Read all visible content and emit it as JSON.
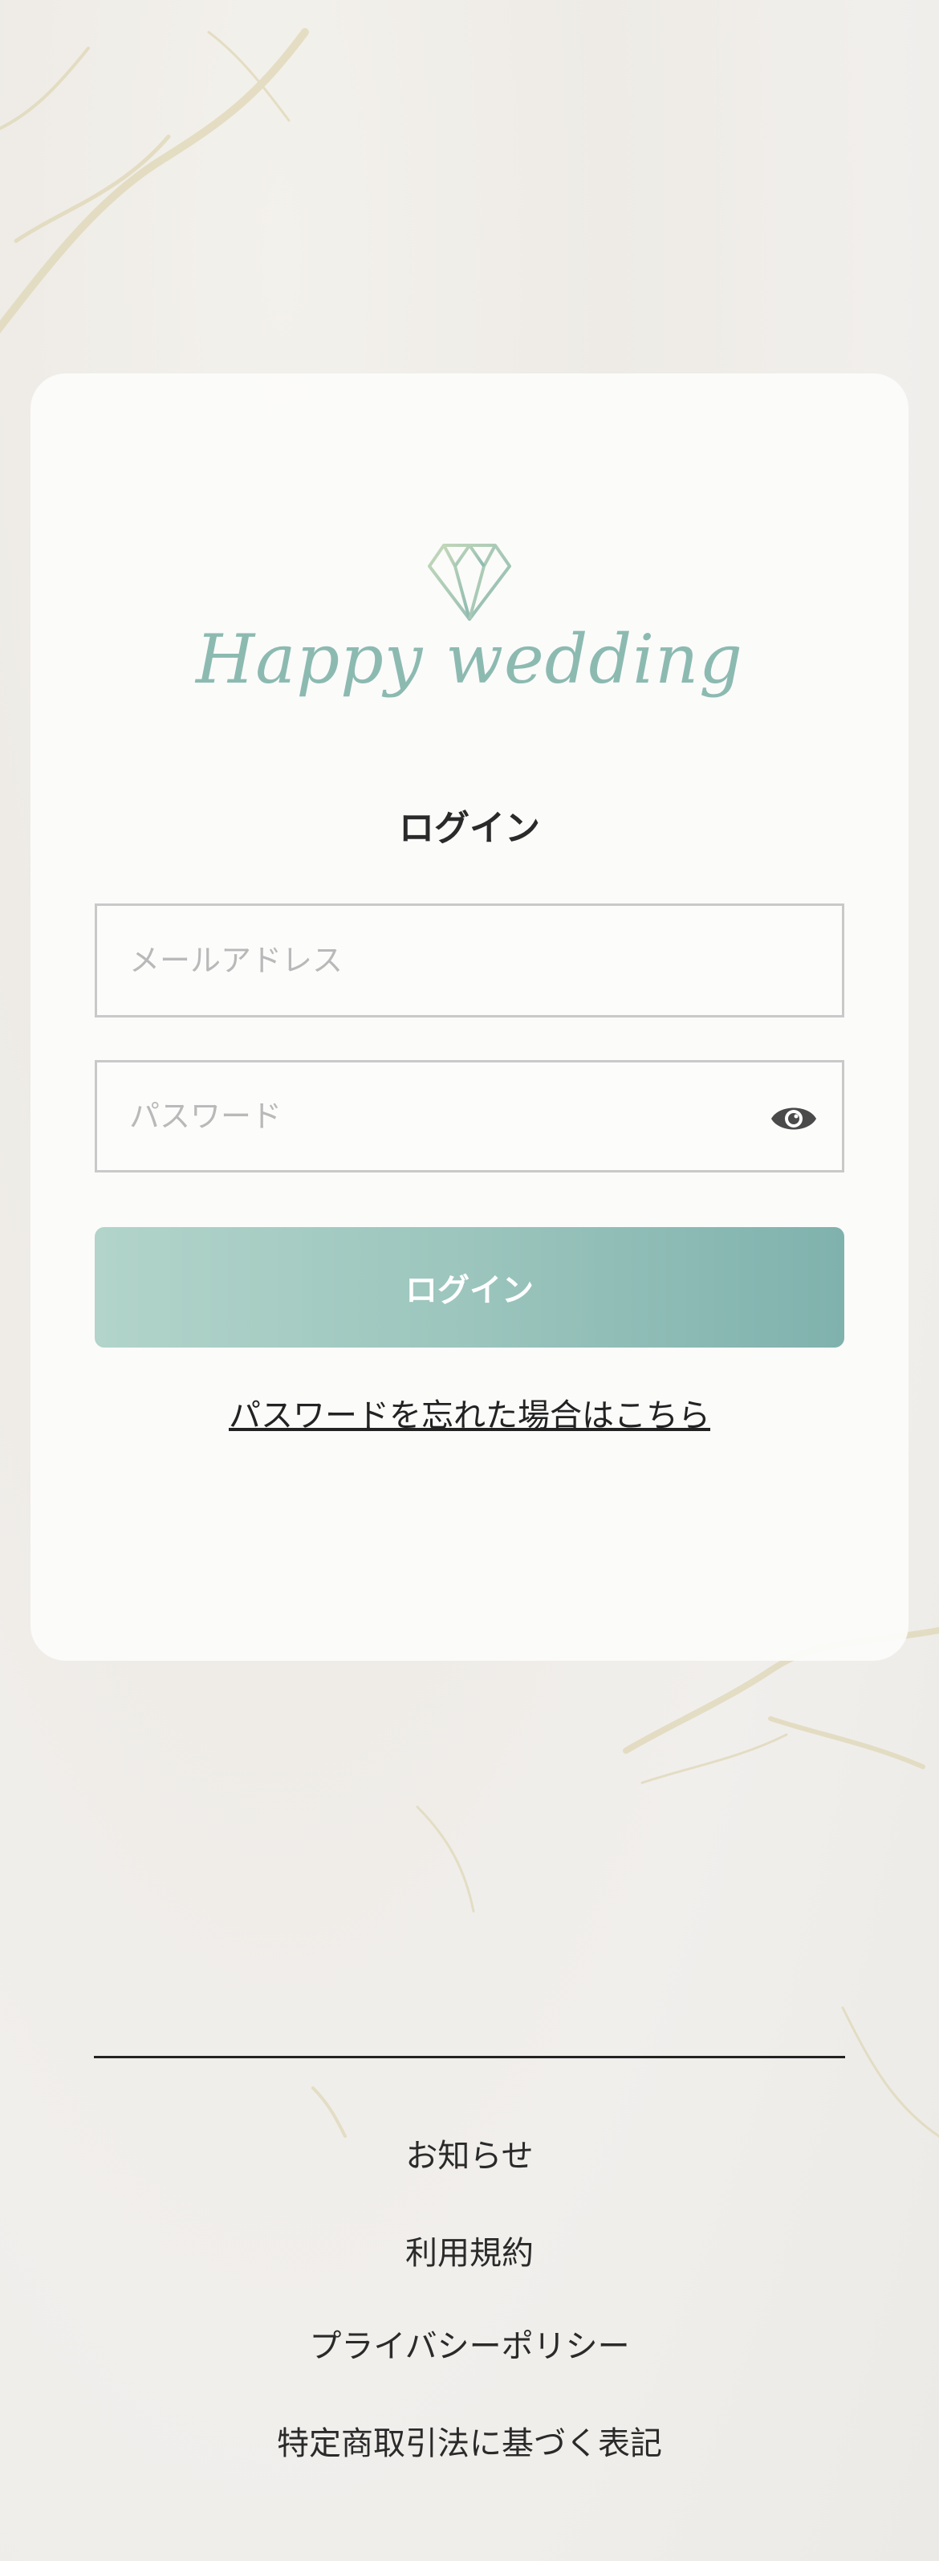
{
  "brand": {
    "logo_text": "Happy wedding",
    "logo_icon": "diamond-icon",
    "accent_color": "#8cbab1"
  },
  "login": {
    "title": "ログイン",
    "email_placeholder": "メールアドレス",
    "password_placeholder": "パスワード",
    "password_toggle_icon": "eye-icon",
    "submit_label": "ログイン",
    "forgot_password_label": "パスワードを忘れた場合はこちら"
  },
  "footer": {
    "links": [
      "お知らせ",
      "利用規約",
      "プライバシーポリシー",
      "特定商取引法に基づく表記"
    ]
  }
}
